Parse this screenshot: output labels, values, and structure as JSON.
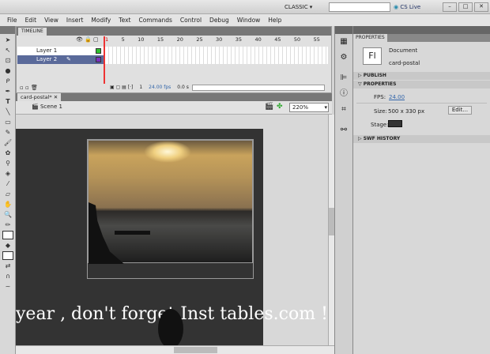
{
  "titlebar": {
    "workspace": "CLASSIC",
    "search_placeholder": "",
    "cs_live": "CS Live"
  },
  "menu": [
    "File",
    "Edit",
    "View",
    "Insert",
    "Modify",
    "Text",
    "Commands",
    "Control",
    "Debug",
    "Window",
    "Help"
  ],
  "timeline": {
    "tab": "TIMELINE",
    "ruler": [
      "1",
      "5",
      "10",
      "15",
      "20",
      "25",
      "30",
      "35",
      "40",
      "45",
      "50",
      "55"
    ],
    "layers": [
      {
        "name": "Layer 1",
        "color": "#2fbf2f"
      },
      {
        "name": "Layer 2",
        "color": "#7a2fbf"
      }
    ],
    "status": {
      "frame": "1",
      "fps": "24.00 fps",
      "time": "0.0 s"
    }
  },
  "document": {
    "tab": "card-postal*",
    "scene": "Scene 1",
    "zoom": "220%",
    "card_text": "year , don't forget Inst     tables.com !"
  },
  "properties": {
    "tab": "PROPERTIES",
    "doc_type": "Document",
    "doc_name": "card-postal",
    "fl_label": "Fl",
    "publish": "PUBLISH",
    "properties": "PROPERTIES",
    "fps_label": "FPS:",
    "fps": "24.00",
    "size_label": "Size:",
    "size": "500 x 330 px",
    "edit_button": "Edit...",
    "stage_label": "Stage:",
    "stage_color": "#333333",
    "swf_history": "SWF HISTORY"
  }
}
